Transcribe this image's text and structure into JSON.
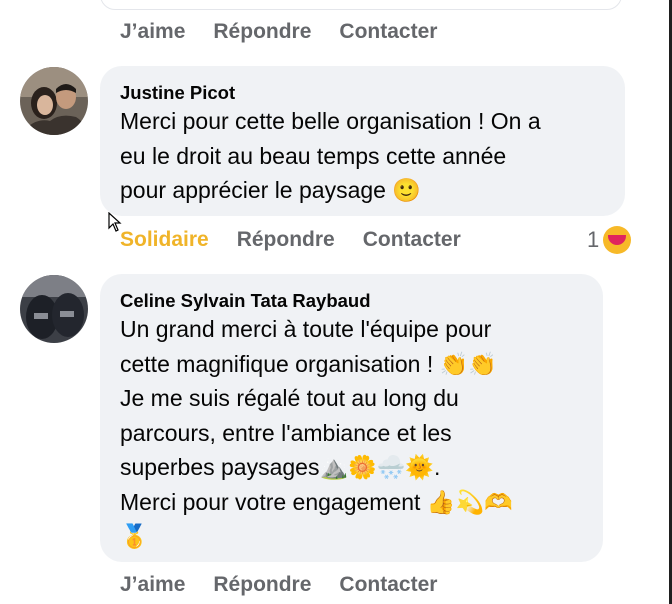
{
  "top_actions": {
    "like": "J’aime",
    "reply": "Répondre",
    "contact": "Contacter"
  },
  "comments": [
    {
      "author": "Justine Picot",
      "lines": [
        "Merci pour cette belle organisation ! On a",
        "eu le droit au beau temps cette année",
        "pour apprécier le paysage 🙂"
      ],
      "actions": {
        "like": "Solidaire",
        "reply": "Répondre",
        "contact": "Contacter"
      },
      "reaction_count": "1"
    },
    {
      "author": "Celine Sylvain Tata Raybaud",
      "lines": [
        "Un grand merci à toute l'équipe pour",
        "cette magnifique organisation ! 👏👏",
        "Je me suis régalé tout au long du",
        "parcours, entre l'ambiance et les",
        "superbes paysages⛰️🌼🌨️🌞.",
        "Merci pour votre engagement 👍💫🫶",
        "🥇"
      ],
      "actions": {
        "like": "J’aime",
        "reply": "Répondre",
        "contact": "Contacter"
      }
    }
  ],
  "icons": {
    "reaction": "care-reaction-icon",
    "cursor": "mouse-pointer-icon"
  },
  "colors": {
    "liked": "#f0b429",
    "action": "#65676b",
    "bubble": "#f0f2f5"
  }
}
